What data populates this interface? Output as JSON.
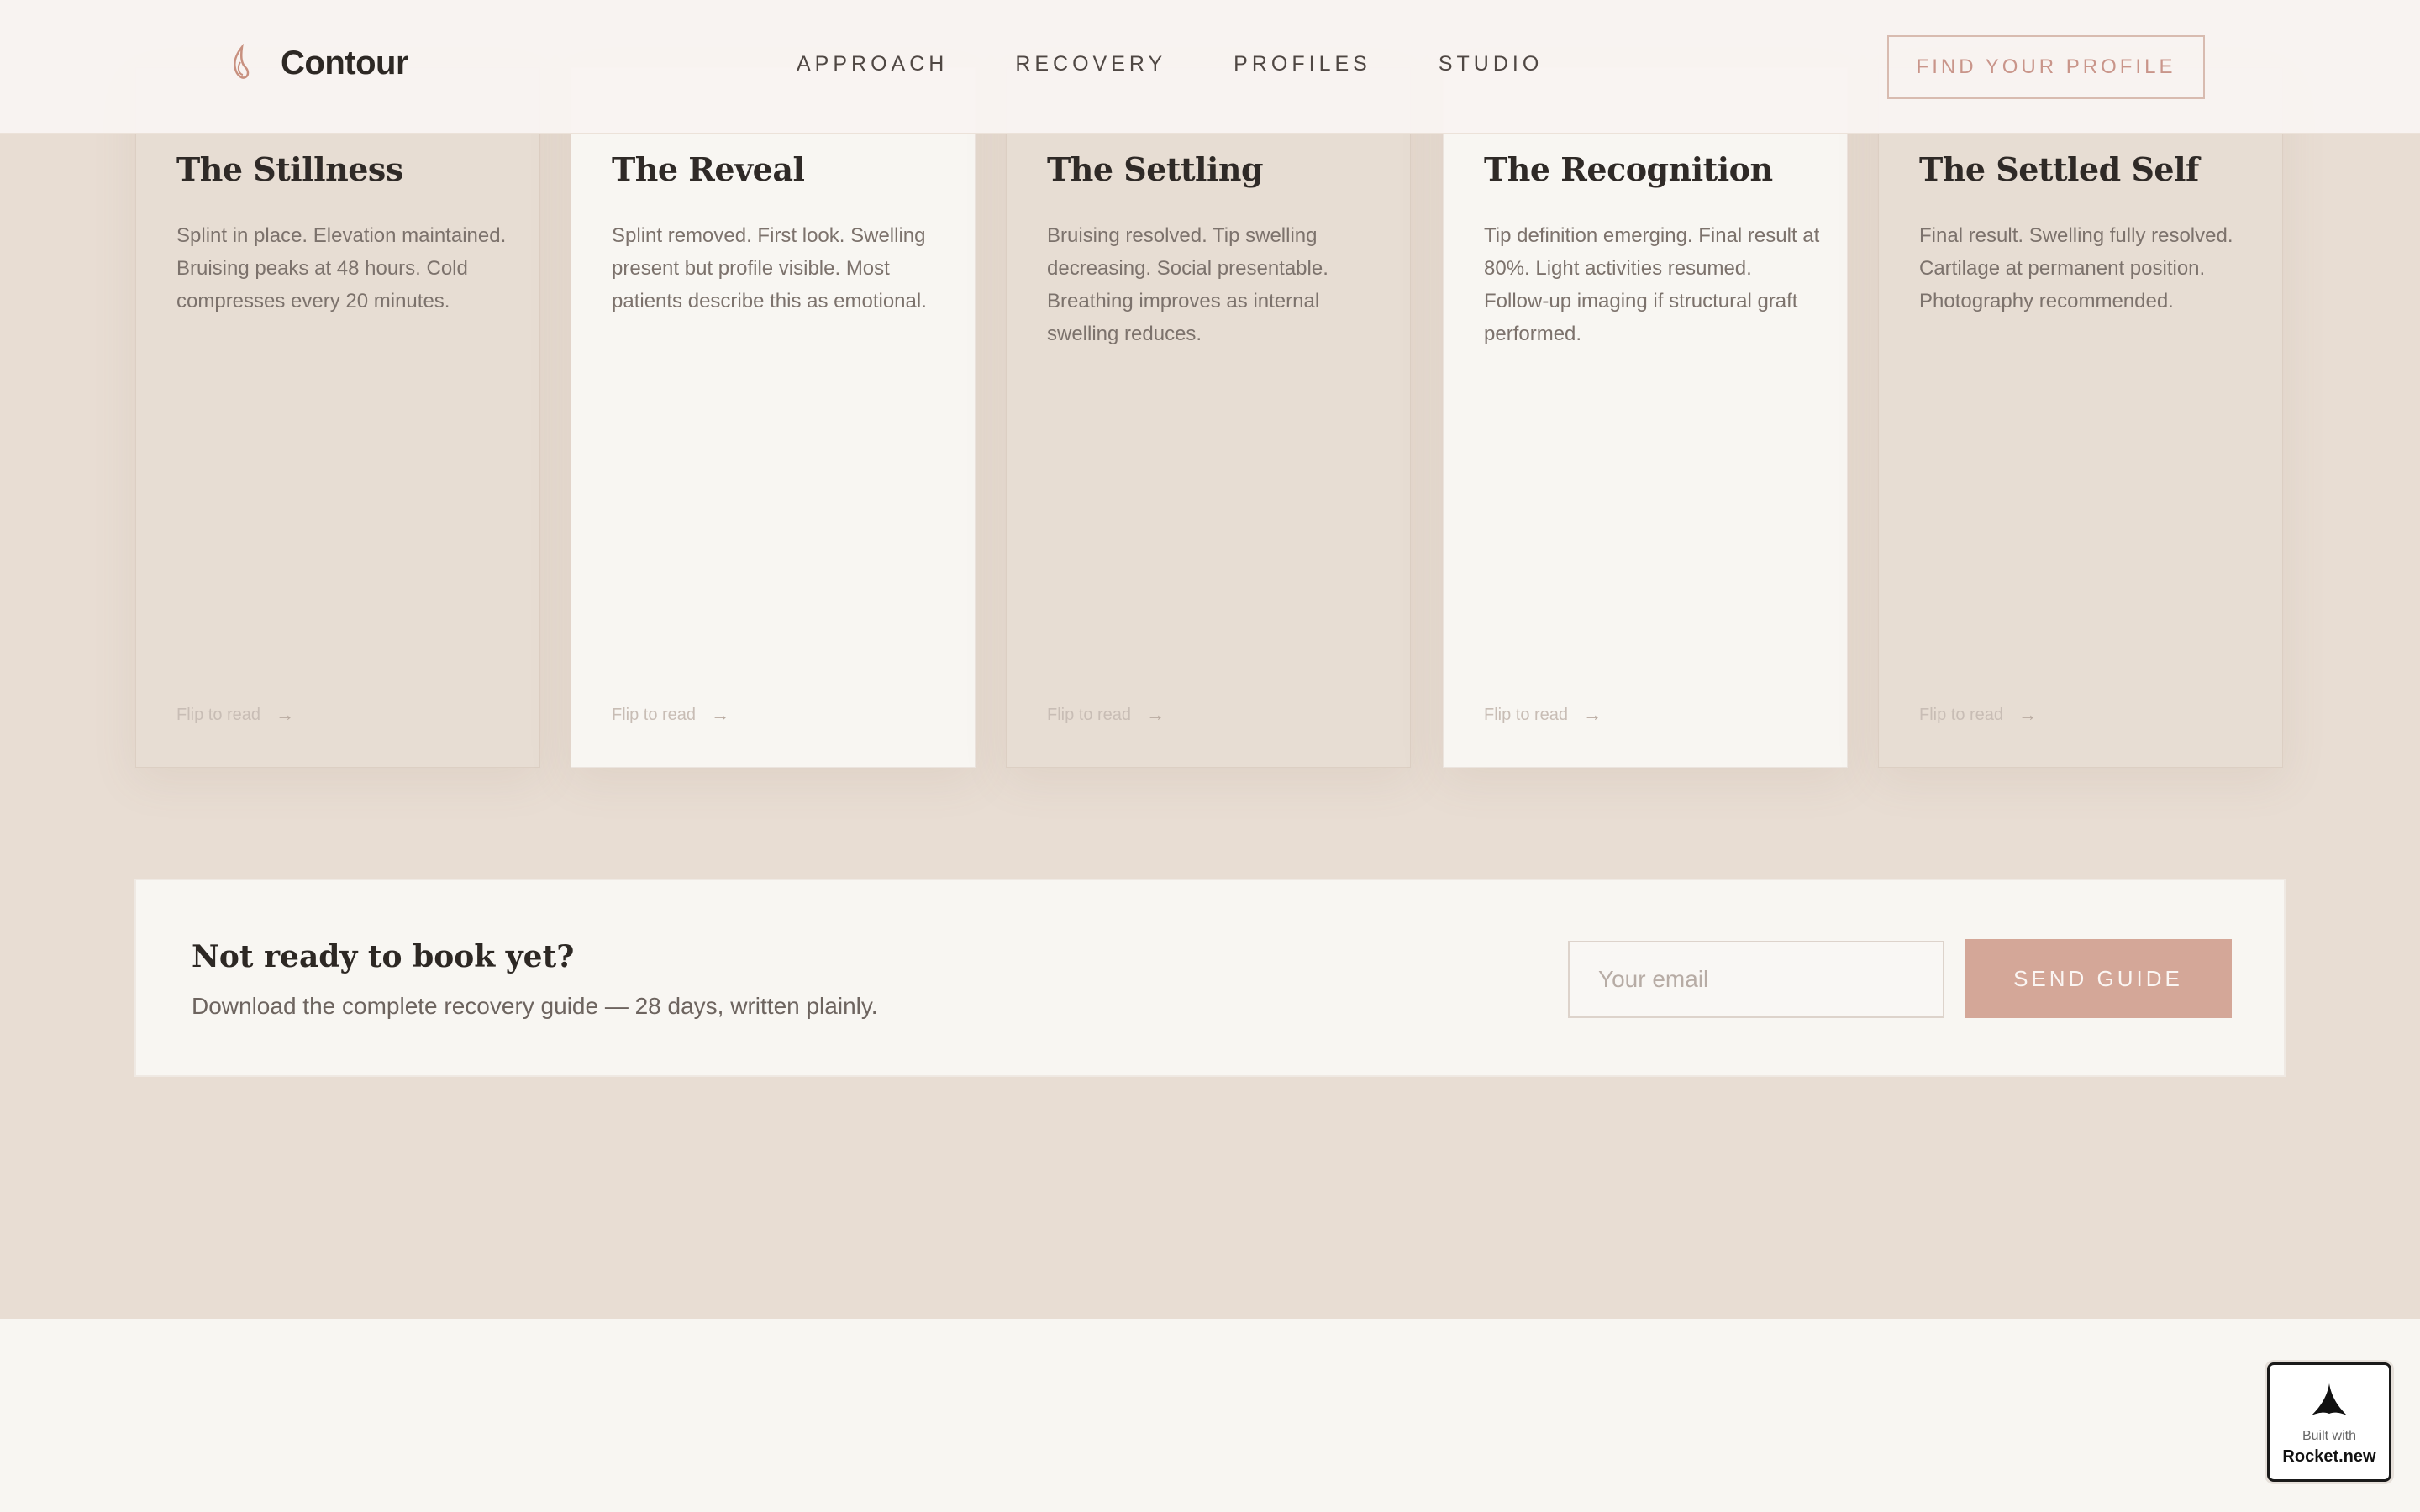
{
  "header": {
    "brand": "Contour",
    "nav": [
      {
        "label": "APPROACH"
      },
      {
        "label": "RECOVERY"
      },
      {
        "label": "PROFILES"
      },
      {
        "label": "STUDIO"
      }
    ],
    "cta_label": "FIND YOUR PROFILE"
  },
  "cards": [
    {
      "tag": "",
      "title": "The Stillness",
      "desc": "Splint in place. Elevation maintained. Bruising peaks at 48 hours. Cold compresses every 20 minutes.",
      "flip": "Flip to read"
    },
    {
      "tag": "",
      "title": "The Reveal",
      "desc": "Splint removed. First look. Swelling present but profile visible. Most patients describe this as emotional.",
      "flip": "Flip to read"
    },
    {
      "tag": "",
      "title": "The Settling",
      "desc": "Bruising resolved. Tip swelling decreasing. Social presentable. Breathing improves as internal swelling reduces.",
      "flip": "Flip to read"
    },
    {
      "tag": "",
      "title": "The Recognition",
      "desc": "Tip definition emerging. Final result at 80%. Light activities resumed. Follow-up imaging if structural graft performed.",
      "flip": "Flip to read"
    },
    {
      "tag": "",
      "title": "The Settled Self",
      "desc": "Final result. Swelling fully resolved. Cartilage at permanent position. Photography recommended.",
      "flip": "Flip to read"
    }
  ],
  "newsletter": {
    "title": "Not ready to book yet?",
    "subtitle": "Download the complete recovery guide — 28 days, written plainly.",
    "email_placeholder": "Your email",
    "button_label": "SEND GUIDE"
  },
  "badge": {
    "small": "Built with",
    "big": "Rocket.new"
  },
  "colors": {
    "accent": "#d4a798",
    "background": "#e8ddd3",
    "card_light": "#f8f6f2"
  }
}
